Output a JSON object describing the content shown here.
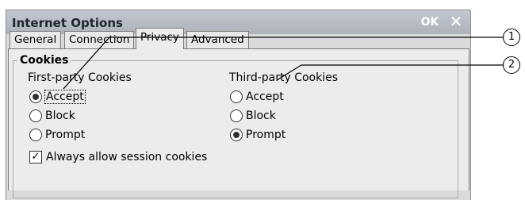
{
  "window": {
    "title": "Internet Options",
    "ok_label": "OK",
    "close_glyph": "✕"
  },
  "tabs": [
    {
      "label": "General",
      "active": false
    },
    {
      "label": "Connection",
      "active": false
    },
    {
      "label": "Privacy",
      "active": true
    },
    {
      "label": "Advanced",
      "active": false
    }
  ],
  "cookies": {
    "group_title": "Cookies",
    "first_party": {
      "label": "First-party Cookies",
      "options": [
        {
          "label": "Accept",
          "selected": true
        },
        {
          "label": "Block",
          "selected": false
        },
        {
          "label": "Prompt",
          "selected": false
        }
      ]
    },
    "third_party": {
      "label": "Third-party Cookies",
      "options": [
        {
          "label": "Accept",
          "selected": false
        },
        {
          "label": "Block",
          "selected": false
        },
        {
          "label": "Prompt",
          "selected": true
        }
      ]
    },
    "session_checkbox": {
      "label": "Always allow session cookies",
      "checked": true,
      "glyph": "✓"
    }
  },
  "callouts": [
    {
      "number": "1"
    },
    {
      "number": "2"
    }
  ]
}
